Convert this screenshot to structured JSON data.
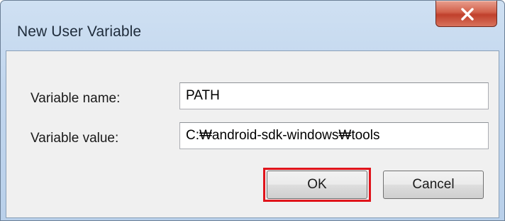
{
  "dialog": {
    "title": "New User Variable",
    "close_icon": "close-x-icon"
  },
  "form": {
    "name_label": "Variable name:",
    "name_value": "PATH",
    "value_label": "Variable value:",
    "value_value": "C:₩android-sdk-windows₩tools"
  },
  "buttons": {
    "ok_label": "OK",
    "cancel_label": "Cancel"
  },
  "colors": {
    "highlight": "#e0141b",
    "close_button": "#c0402c"
  }
}
